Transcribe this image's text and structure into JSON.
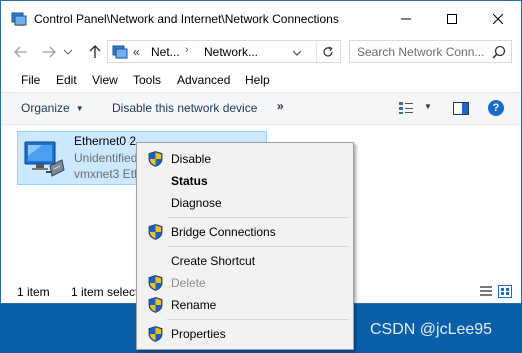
{
  "window": {
    "title": "Control Panel\\Network and Internet\\Network Connections",
    "controls": {
      "minimize_icon": "minimize-icon",
      "maximize_icon": "maximize-icon",
      "close_icon": "close-icon"
    }
  },
  "address_bar": {
    "prefix": "«",
    "segments": [
      "Net...",
      "Network..."
    ],
    "search_placeholder": "Search Network Conn..."
  },
  "menubar": {
    "items": [
      "File",
      "Edit",
      "View",
      "Tools",
      "Advanced",
      "Help"
    ]
  },
  "command_bar": {
    "organize": "Organize",
    "disable_device": "Disable this network device",
    "more": "»"
  },
  "connection": {
    "name": "Ethernet0 2",
    "status": "Unidentified",
    "device": "vmxnet3 Eth"
  },
  "status_bar": {
    "count": "1 item",
    "selected": "1 item selected"
  },
  "context_menu": {
    "items": [
      {
        "label": "Disable",
        "shield": true,
        "bold": false,
        "disabled": false
      },
      {
        "label": "Status",
        "shield": false,
        "bold": true,
        "disabled": false
      },
      {
        "label": "Diagnose",
        "shield": false,
        "bold": false,
        "disabled": false
      },
      {
        "label": "Bridge Connections",
        "shield": true,
        "bold": false,
        "disabled": false
      },
      {
        "label": "Create Shortcut",
        "shield": false,
        "bold": false,
        "disabled": false
      },
      {
        "label": "Delete",
        "shield": true,
        "bold": false,
        "disabled": true
      },
      {
        "label": "Rename",
        "shield": true,
        "bold": false,
        "disabled": false
      },
      {
        "label": "Properties",
        "shield": true,
        "bold": false,
        "disabled": false
      }
    ]
  },
  "watermark": "CSDN @jcLee95",
  "colors": {
    "desktop": "#0a5fab",
    "selection": "#cce8ff",
    "menu_bg": "#f2f2f2",
    "shield_blue": "#1f5fbf",
    "shield_yellow": "#f2c01d"
  }
}
